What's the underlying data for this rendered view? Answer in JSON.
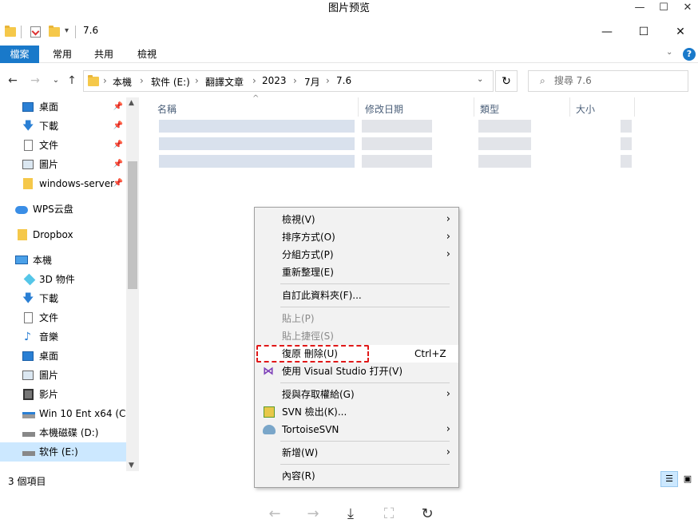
{
  "window": {
    "title": "图片预览",
    "explorer_title": "7.6",
    "controls": {
      "minimize": "—",
      "maximize": "☐",
      "close": "✕"
    }
  },
  "ribbon": {
    "tabs": [
      {
        "label": "檔案",
        "active": true
      },
      {
        "label": "常用"
      },
      {
        "label": "共用"
      },
      {
        "label": "檢視"
      }
    ],
    "help_icon": "?"
  },
  "address": {
    "segments": [
      "本機",
      "软件 (E:)",
      "翻譯文章",
      "2023",
      "7月",
      "7.6"
    ],
    "search_placeholder": "搜尋 7.6"
  },
  "navigation": {
    "items": [
      {
        "label": "桌面",
        "icon": "desktop-icon",
        "pinned": true
      },
      {
        "label": "下載",
        "icon": "download-icon",
        "pinned": true
      },
      {
        "label": "文件",
        "icon": "document-icon",
        "pinned": true
      },
      {
        "label": "圖片",
        "icon": "picture-icon",
        "pinned": true
      },
      {
        "label": "windows-server",
        "icon": "folder-icon",
        "pinned": true
      },
      {
        "label": "WPS云盘",
        "icon": "cloud-icon"
      },
      {
        "label": "Dropbox",
        "icon": "folder-icon"
      },
      {
        "label": "本機",
        "icon": "computer-icon"
      },
      {
        "label": "3D 物件",
        "icon": "cube-icon"
      },
      {
        "label": "下載",
        "icon": "download-icon"
      },
      {
        "label": "文件",
        "icon": "document-icon"
      },
      {
        "label": "音樂",
        "icon": "music-icon"
      },
      {
        "label": "桌面",
        "icon": "desktop-icon"
      },
      {
        "label": "圖片",
        "icon": "picture-icon"
      },
      {
        "label": "影片",
        "icon": "video-icon"
      },
      {
        "label": "Win 10 Ent x64 (C:)",
        "icon": "drive-os-icon"
      },
      {
        "label": "本機磁碟 (D:)",
        "icon": "drive-icon"
      },
      {
        "label": "软件 (E:)",
        "icon": "drive-icon",
        "selected": true
      }
    ]
  },
  "columns": {
    "name": "名稱",
    "modified": "修改日期",
    "type": "類型",
    "size": "大小"
  },
  "context_menu": {
    "items": [
      {
        "label": "檢視(V)",
        "submenu": true
      },
      {
        "label": "排序方式(O)",
        "submenu": true
      },
      {
        "label": "分組方式(P)",
        "submenu": true
      },
      {
        "label": "重新整理(E)"
      },
      {
        "label": "自訂此資料夾(F)..."
      },
      {
        "label": "貼上(P)",
        "disabled": true
      },
      {
        "label": "貼上捷徑(S)",
        "disabled": true
      },
      {
        "label": "復原 刪除(U)",
        "shortcut": "Ctrl+Z",
        "highlighted": true
      },
      {
        "label": "使用 Visual Studio 打开(V)",
        "icon": "visual-studio-icon"
      },
      {
        "label": "授與存取權給(G)",
        "submenu": true
      },
      {
        "label": "SVN 檢出(K)...",
        "icon": "svn-icon"
      },
      {
        "label": "TortoiseSVN",
        "icon": "tortoise-icon",
        "submenu": true
      },
      {
        "label": "新增(W)",
        "submenu": true
      },
      {
        "label": "內容(R)"
      }
    ]
  },
  "status": {
    "item_count": "3 個項目"
  },
  "accent_color": "#1979ca",
  "highlight_color": "#e01818"
}
